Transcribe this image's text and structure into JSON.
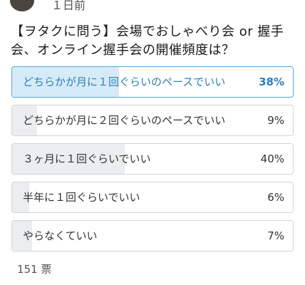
{
  "post": {
    "time_ago": "１日前",
    "question": "【ヲタクに問う】会場でおしゃべり会 or 握手会、オンライン握手会の開催頻度は？"
  },
  "poll": {
    "options": [
      {
        "label": "どちらかが月に１回ぐらいのペースでいい",
        "percent_label": "38%",
        "percent": 38,
        "selected": true
      },
      {
        "label": "どちらかが月に２回ぐらいのペースでいい",
        "percent_label": "9%",
        "percent": 9,
        "selected": false
      },
      {
        "label": "３ヶ月に１回ぐらいでいい",
        "percent_label": "40%",
        "percent": 40,
        "selected": false
      },
      {
        "label": "半年に１回ぐらいでいい",
        "percent_label": "6%",
        "percent": 6,
        "selected": false
      },
      {
        "label": "やらなくていい",
        "percent_label": "7%",
        "percent": 7,
        "selected": false
      }
    ],
    "votes_label": "151 票"
  },
  "colors": {
    "selected_border": "#55a8df",
    "selected_fill": "#d6ebf8",
    "selected_text": "#2a7fc0",
    "option_fill": "#ebedef",
    "option_border": "#cfd6dc"
  }
}
